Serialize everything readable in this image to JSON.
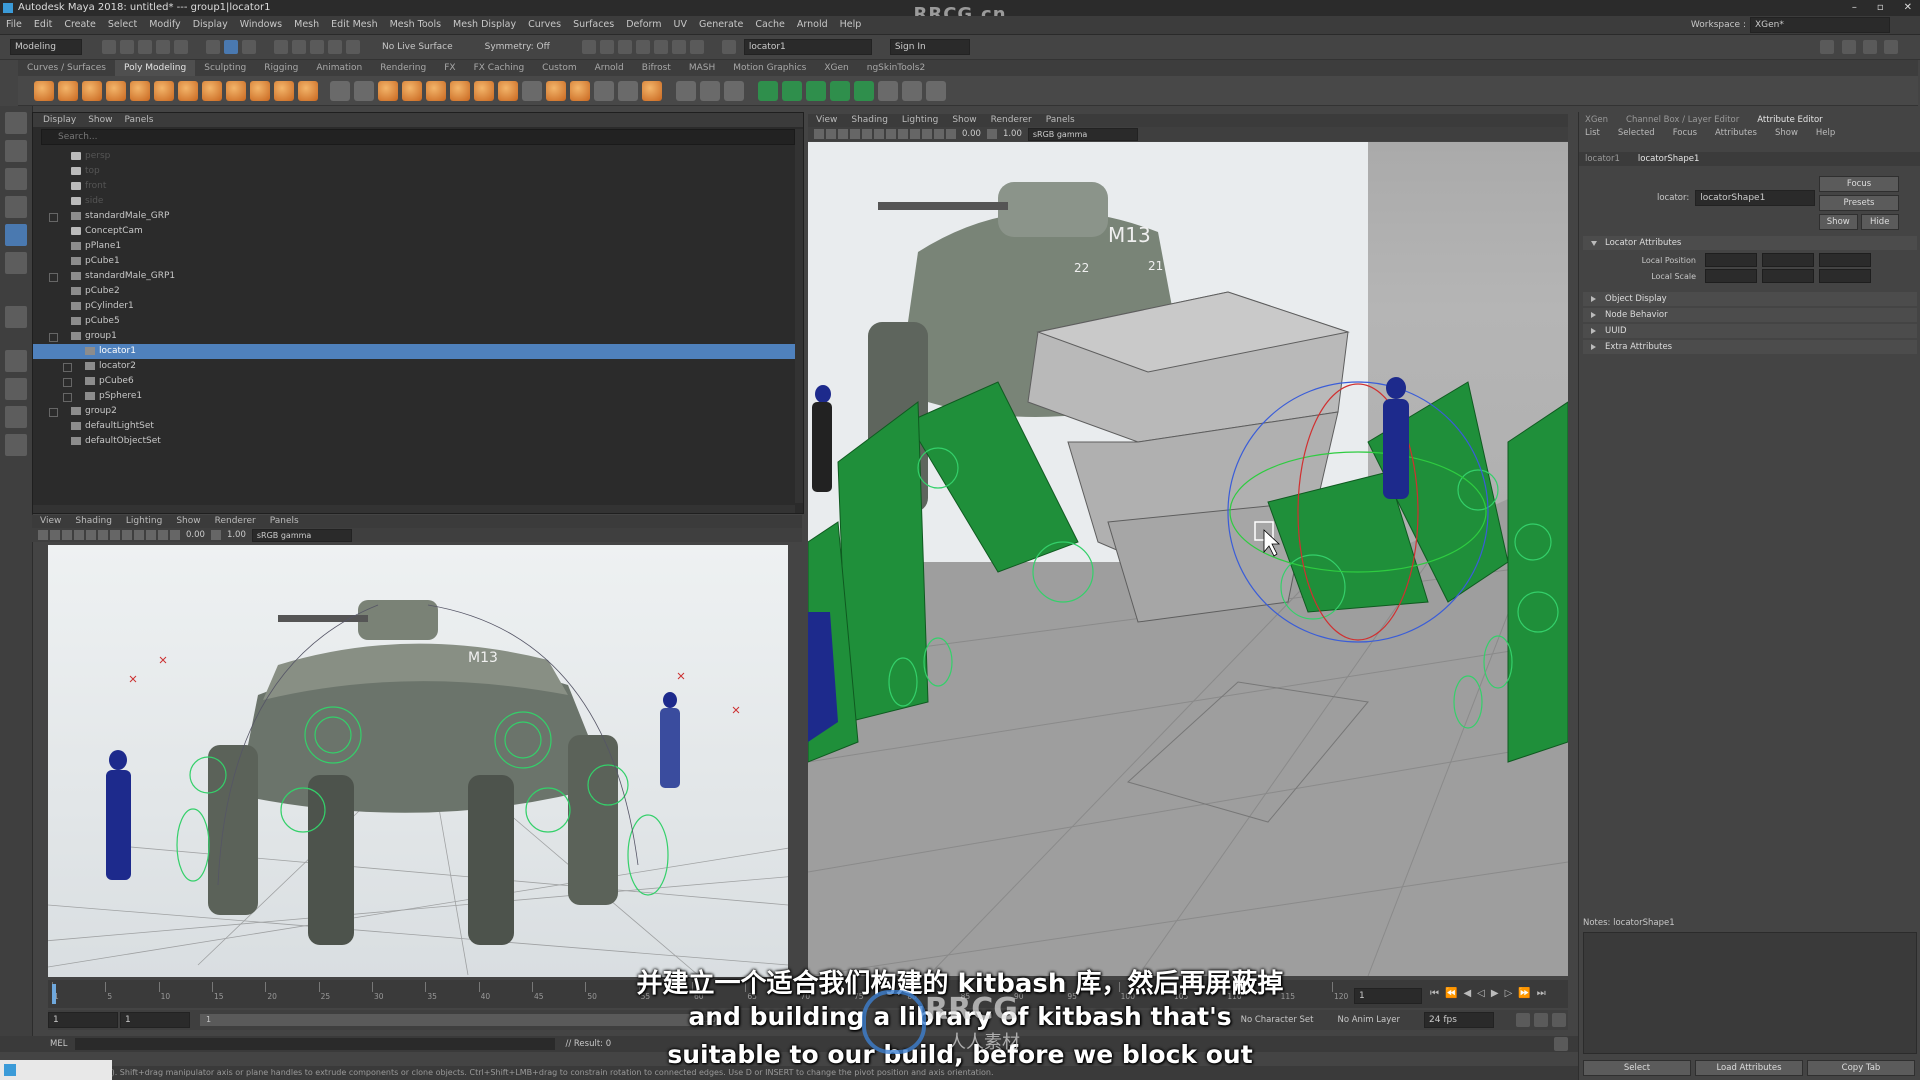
{
  "window": {
    "title": "Autodesk Maya 2018: untitled*  ---  group1|locator1",
    "watermark": "RRCG.cn",
    "controls": [
      "–",
      "▫",
      "✕"
    ]
  },
  "menubar": {
    "items": [
      "File",
      "Edit",
      "Create",
      "Select",
      "Modify",
      "Display",
      "Windows",
      "Mesh",
      "Edit Mesh",
      "Mesh Tools",
      "Mesh Display",
      "Curves",
      "Surfaces",
      "Deform",
      "UV",
      "Generate",
      "Cache",
      "Arnold",
      "Help"
    ],
    "workspace_label": "Workspace :",
    "workspace_value": "XGen*"
  },
  "statusline": {
    "mode": "Modeling",
    "live_surface": "No Live Surface",
    "symmetry": "Symmetry: Off",
    "selection_field": "locator1",
    "sign_in": "Sign In"
  },
  "shelf": {
    "tabs": [
      "Curves / Surfaces",
      "Poly Modeling",
      "Sculpting",
      "Rigging",
      "Animation",
      "Rendering",
      "FX",
      "FX Caching",
      "Custom",
      "Arnold",
      "Bifrost",
      "MASH",
      "Motion Graphics",
      "XGen",
      "ngSkinTools2"
    ],
    "active_tab": "Poly Modeling"
  },
  "outliner": {
    "menu": [
      "Display",
      "Show",
      "Panels"
    ],
    "search_placeholder": "Search...",
    "items": [
      {
        "label": "persp",
        "indent": 0,
        "dim": true,
        "icon": "camera"
      },
      {
        "label": "top",
        "indent": 0,
        "dim": true,
        "icon": "camera"
      },
      {
        "label": "front",
        "indent": 0,
        "dim": true,
        "icon": "camera"
      },
      {
        "label": "side",
        "indent": 0,
        "dim": true,
        "icon": "camera"
      },
      {
        "label": "standardMale_GRP",
        "indent": 0,
        "expand": true,
        "icon": "group"
      },
      {
        "label": "ConceptCam",
        "indent": 0,
        "icon": "camera"
      },
      {
        "label": "pPlane1",
        "indent": 0,
        "icon": "mesh"
      },
      {
        "label": "pCube1",
        "indent": 0,
        "icon": "mesh"
      },
      {
        "label": "standardMale_GRP1",
        "indent": 0,
        "expand": true,
        "icon": "group"
      },
      {
        "label": "pCube2",
        "indent": 0,
        "icon": "mesh"
      },
      {
        "label": "pCylinder1",
        "indent": 0,
        "icon": "mesh"
      },
      {
        "label": "pCube5",
        "indent": 0,
        "icon": "mesh"
      },
      {
        "label": "group1",
        "indent": 0,
        "expand": true,
        "icon": "group"
      },
      {
        "label": "locator1",
        "indent": 1,
        "selected": true,
        "icon": "locator"
      },
      {
        "label": "locator2",
        "indent": 1,
        "expand": true,
        "icon": "locator"
      },
      {
        "label": "pCube6",
        "indent": 1,
        "expand": true,
        "icon": "mesh"
      },
      {
        "label": "pSphere1",
        "indent": 1,
        "expand": true,
        "icon": "mesh"
      },
      {
        "label": "group2",
        "indent": 0,
        "expand": true,
        "icon": "group"
      },
      {
        "label": "defaultLightSet",
        "indent": 0,
        "icon": "set"
      },
      {
        "label": "defaultObjectSet",
        "indent": 0,
        "icon": "set"
      }
    ]
  },
  "viewport_bl": {
    "menu": [
      "View",
      "Shading",
      "Lighting",
      "Show",
      "Renderer",
      "Panels"
    ],
    "field_a": "0.00",
    "field_b": "1.00",
    "color_space": "sRGB gamma",
    "badge": "M13"
  },
  "viewport_r": {
    "menu": [
      "View",
      "Shading",
      "Lighting",
      "Show",
      "Renderer",
      "Panels"
    ],
    "field_a": "0.00",
    "field_b": "1.00",
    "color_space": "sRGB gamma",
    "badge": "M13",
    "num_left": "22",
    "num_right": "21"
  },
  "attribute_editor": {
    "top_tabs": [
      "XGen",
      "Channel Box / Layer Editor",
      "Attribute Editor"
    ],
    "active_top_tab": "Attribute Editor",
    "menu": [
      "List",
      "Selected",
      "Focus",
      "Attributes",
      "Show",
      "Help"
    ],
    "node_tabs": [
      "locator1",
      "locatorShape1"
    ],
    "active_node_tab": "locatorShape1",
    "node_label": "locator:",
    "node_value": "locatorShape1",
    "focus_btn": "Focus",
    "presets_btn": "Presets",
    "show_btn": "Show",
    "hide_btn": "Hide",
    "sections": [
      {
        "label": "Locator Attributes",
        "open": true
      },
      {
        "label": "Object Display",
        "open": false
      },
      {
        "label": "Node Behavior",
        "open": false
      },
      {
        "label": "UUID",
        "open": false
      },
      {
        "label": "Extra Attributes",
        "open": false
      }
    ],
    "local_position_label": "Local Position",
    "local_scale_label": "Local Scale",
    "notes_label": "Notes:  locatorShape1",
    "bottom_buttons": [
      "Select",
      "Load Attributes",
      "Copy Tab"
    ]
  },
  "timeline": {
    "ticks": [
      "1",
      "5",
      "10",
      "15",
      "20",
      "25",
      "30",
      "35",
      "40",
      "45",
      "50",
      "55",
      "60",
      "65",
      "70",
      "75",
      "80",
      "85",
      "90",
      "95",
      "100",
      "105",
      "110",
      "115",
      "120"
    ],
    "current_frame": "1",
    "range_start": "1",
    "range_start2": "1",
    "range_inner": "1",
    "range_end": "120",
    "no_char_set": "No Character Set",
    "no_anim_layer": "No Anim Layer",
    "fps": "24 fps"
  },
  "command_line": {
    "language": "MEL",
    "result": "// Result: 0"
  },
  "help_line": "nipulator to rotate object(s). Shift+drag manipulator axis or plane handles to extrude components or clone objects. Ctrl+Shift+LMB+drag to constrain rotation to connected edges. Use D or INSERT to change the pivot position and axis orientation.",
  "subtitles": {
    "zh": "并建立一个适合我们构建的 kitbash 库，然后再屏蔽掉",
    "en1": "and building a library of kitbash that's",
    "en2": "suitable to our build, before we block out",
    "logo_text": "RRCG",
    "logo_sub": "人人素材"
  },
  "colors": {
    "selection": "#4f81bd",
    "shelf_orange": "#e0883a",
    "wire_green": "#34d06a",
    "solid_green": "#1f8f3a"
  }
}
